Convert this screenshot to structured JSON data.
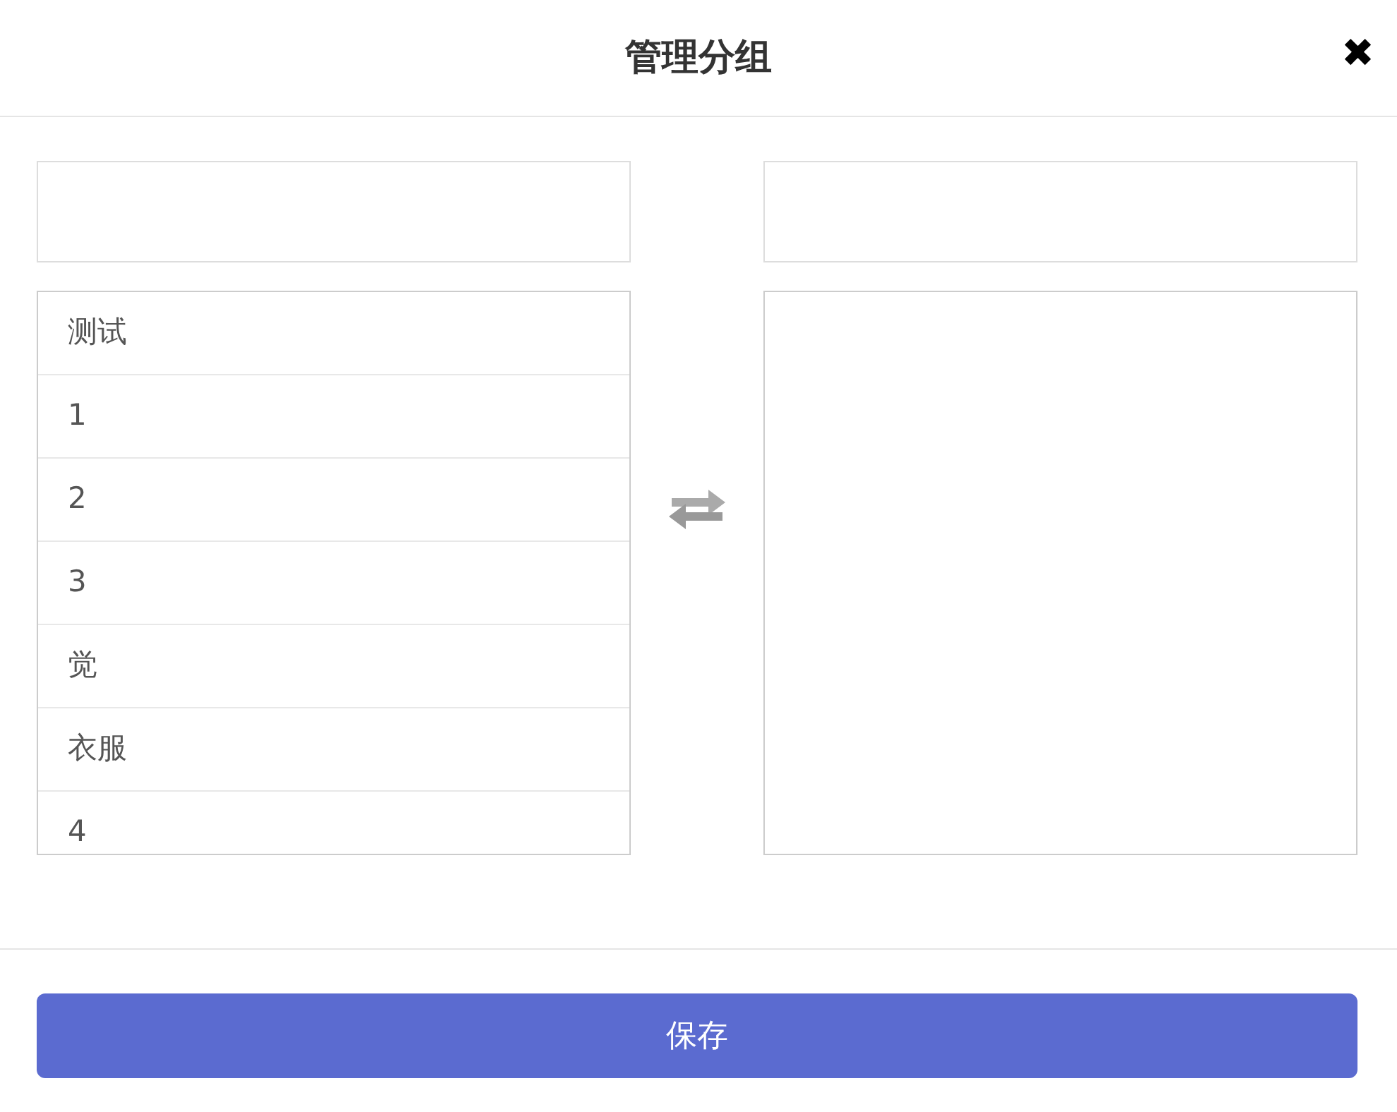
{
  "dialog": {
    "title": "管理分组",
    "close": "✖"
  },
  "left_list": {
    "items": [
      {
        "label": "测试"
      },
      {
        "label": "1"
      },
      {
        "label": "2"
      },
      {
        "label": "3"
      },
      {
        "label": "觉"
      },
      {
        "label": "衣服"
      },
      {
        "label": "4"
      }
    ]
  },
  "save_button": {
    "label": "保存"
  }
}
